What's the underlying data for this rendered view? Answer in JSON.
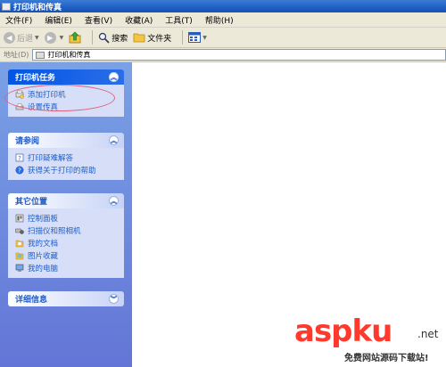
{
  "window": {
    "title": "打印机和传真"
  },
  "menu": [
    "文件(F)",
    "编辑(E)",
    "查看(V)",
    "收藏(A)",
    "工具(T)",
    "帮助(H)"
  ],
  "toolbar": {
    "back_label": "后退",
    "search_label": "搜索",
    "folders_label": "文件夹"
  },
  "address": {
    "label": "地址(D)",
    "value": "打印机和传真"
  },
  "panels": {
    "tasks": {
      "title": "打印机任务",
      "items": [
        "添加打印机",
        "设置传真"
      ]
    },
    "see_also": {
      "title": "请参阅",
      "items": [
        "打印疑难解答",
        "获得关于打印的帮助"
      ]
    },
    "other_places": {
      "title": "其它位置",
      "items": [
        "控制面板",
        "扫描仪和照相机",
        "我的文档",
        "图片收藏",
        "我的电脑"
      ]
    },
    "details": {
      "title": "详细信息"
    }
  },
  "watermark": {
    "logo": "aspku",
    "tld": ".net",
    "subtitle": "免费网站源码下载站!"
  },
  "colors": {
    "title_bar": "#1f5fc4",
    "left_pane": "#6c87dc",
    "link": "#215dc6",
    "highlight": "#e06080"
  }
}
